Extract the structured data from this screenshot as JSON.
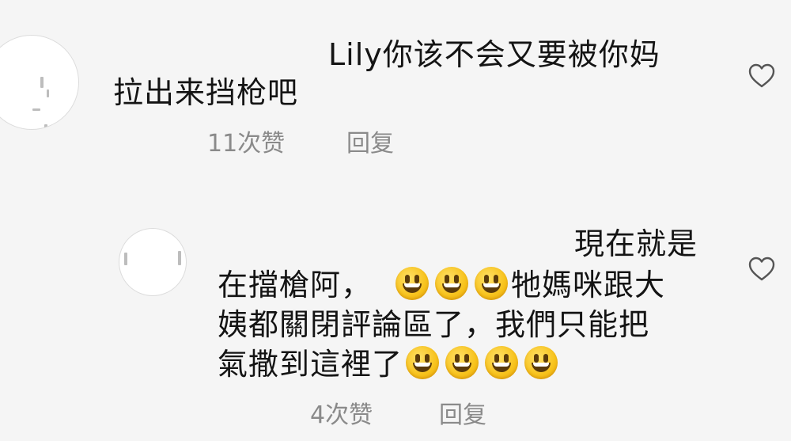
{
  "comments": [
    {
      "lines": [
        "Lily你该不会又要被你妈",
        "拉出来挡枪吧"
      ],
      "likes": "11次赞",
      "reply": "回复",
      "avatar_icon": "avatar",
      "like_icon": "heart-outline"
    },
    {
      "lines": [
        "現在就是",
        "在擋槍阿，",
        "牠媽咪跟大",
        "姨都關閉評論區了，我們只能把",
        "氣撒到這裡了"
      ],
      "emoji": "😃",
      "likes": "4次赞",
      "reply": "回复",
      "avatar_icon": "avatar",
      "like_icon": "heart-outline"
    }
  ],
  "colors": {
    "background": "#f5f5f5",
    "text": "#141414",
    "meta": "#8a8a8a",
    "emoji": "#f7c21b"
  }
}
